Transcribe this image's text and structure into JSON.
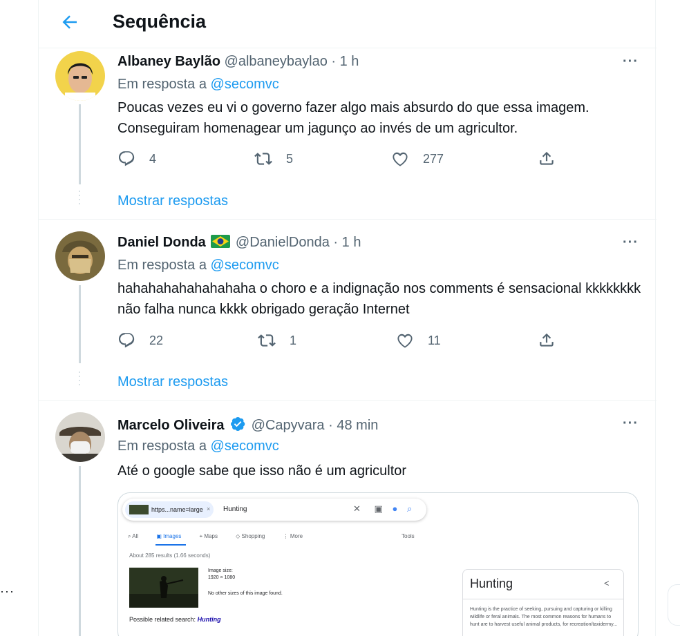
{
  "header": {
    "title": "Sequência"
  },
  "tweets": [
    {
      "name": "Albaney Baylão",
      "handle": "@albaneybaylao",
      "time": "1 h",
      "reply_prefix": "Em resposta a",
      "reply_to": "@secomvc",
      "text": "Poucas vezes eu vi o governo fazer algo mais absurdo do que essa imagem. Conseguiram homenagear um jagunço ao invés de um agricultor.",
      "replies": "4",
      "retweets": "5",
      "likes": "277",
      "show_replies": "Mostrar respostas"
    },
    {
      "name": "Daniel Donda",
      "handle": "@DanielDonda",
      "time": "1 h",
      "reply_prefix": "Em resposta a",
      "reply_to": "@secomvc",
      "text": "hahahahahahahahaha o choro e a indignação nos comments é sensacional kkkkkkkk não falha nunca kkkk obrigado geração Internet",
      "replies": "22",
      "retweets": "1",
      "likes": "11",
      "show_replies": "Mostrar respostas"
    },
    {
      "name": "Marcelo Oliveira",
      "handle": "@Capyvara",
      "time": "48 min",
      "reply_prefix": "Em resposta a",
      "reply_to": "@secomvc",
      "text": "Até o google sabe que isso não é um agricultor"
    }
  ],
  "separator": "·",
  "more": "···",
  "media": {
    "chip_text": "https...name=large",
    "chip_close": "×",
    "query": "Hunting",
    "tabs": [
      "All",
      "Images",
      "Maps",
      "Shopping",
      "More"
    ],
    "tools": "Tools",
    "result_count": "About 285 results (1.66 seconds)",
    "image_size_label": "Image size:",
    "image_size": "1920 × 1080",
    "no_other_sizes": "No other sizes of this image found.",
    "related_label": "Possible related search:",
    "related_term": "Hunting",
    "panel_title": "Hunting",
    "panel_text": "Hunting is the practice of seeking, pursuing and capturing or killing wildlife or feral animals. The most common reasons for humans to hunt are to harvest useful animal products, for recreation/taxidermy..."
  },
  "colors": {
    "accent": "#1d9bf0",
    "text": "#0f1419",
    "secondary": "#536471",
    "border": "#eff3f4"
  }
}
